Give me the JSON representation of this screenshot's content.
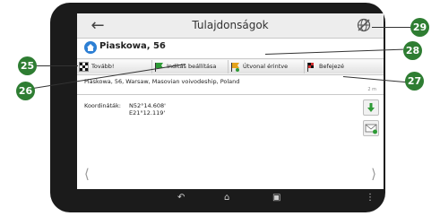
{
  "window": {
    "title": "Tulajdonságok"
  },
  "place": {
    "name": "Piaskowa, 56"
  },
  "toolbar": {
    "continue_label": "Tovább!",
    "set_start_label": "Indítás beállítása",
    "route_touched_label": "Útvonal érintve",
    "finish_label": "Befejezé"
  },
  "details": {
    "address": "Piaskowa, 56, Warsaw, Masovian voivodeship, Poland",
    "distance": "2 m",
    "coordinates_label": "Koordináták:",
    "latitude": "N52°14.608'",
    "longitude": "E21°12.119'"
  },
  "callouts": {
    "c25": "25",
    "c26": "26",
    "c27": "27",
    "c28": "28",
    "c29": "29"
  },
  "colors": {
    "callout": "#2e7d32",
    "bezel": "#1b1b1b",
    "accent": "#2d7fd4"
  },
  "icons": [
    "back-arrow-icon",
    "globe-off-icon",
    "home-icon",
    "checkered-flag-icon",
    "green-flag-icon",
    "route-flag-icon",
    "finish-flag-icon",
    "download-icon",
    "mail-icon",
    "back-softkey-icon",
    "home-softkey-icon",
    "recent-apps-icon"
  ]
}
